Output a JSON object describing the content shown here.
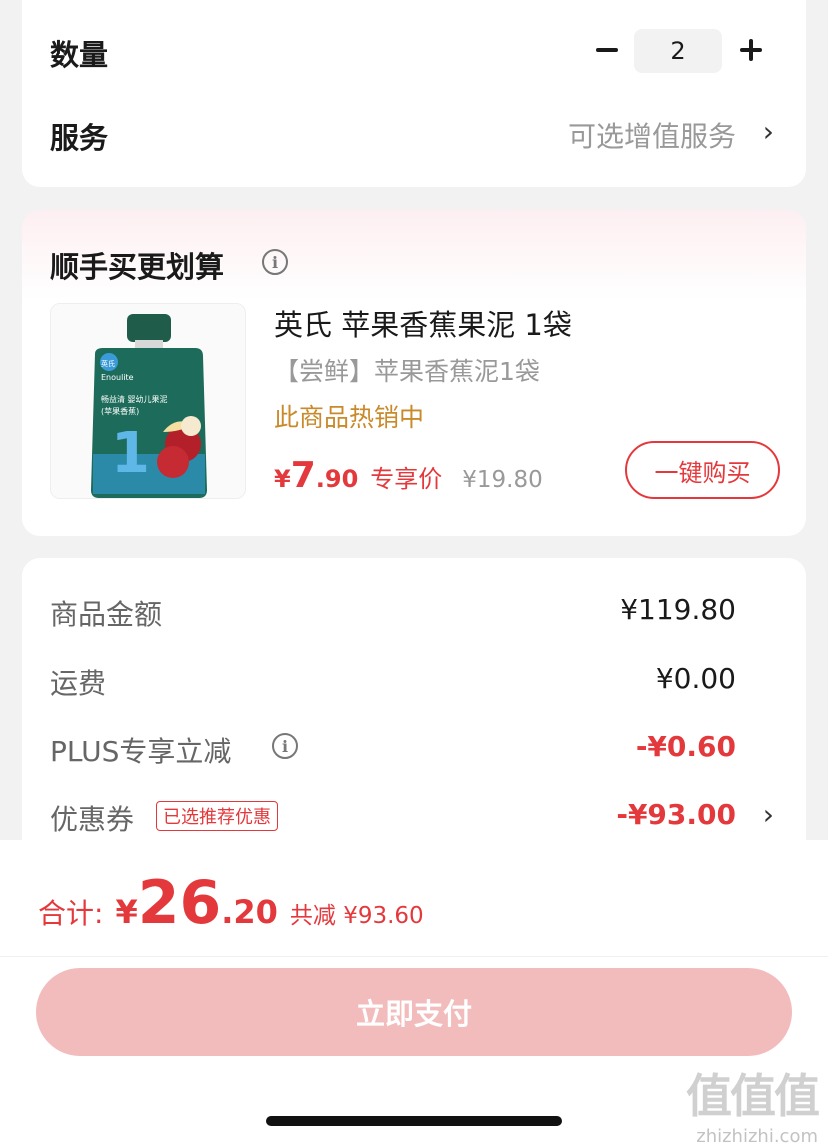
{
  "quantity": {
    "label": "数量",
    "value": "2"
  },
  "service": {
    "label": "服务",
    "value": "可选增值服务"
  },
  "bundle": {
    "title": "顺手买更划算",
    "product": {
      "name": "英氏 苹果香蕉果泥 1袋",
      "subtitle": "【尝鲜】苹果香蕉泥1袋",
      "hot": "此商品热销中",
      "price_yen": "¥",
      "price_int": "7",
      "price_dec": ".90",
      "price_tag": "专享价",
      "original_price": "¥19.80",
      "buy_button": "一键购买",
      "pack_brand": "英氏",
      "pack_brand_en": "Enoulite",
      "pack_name": "畅益清 婴幼儿果泥",
      "pack_flavor": "(苹果香蕉)",
      "pack_stage": "1"
    }
  },
  "amounts": {
    "goods_label": "商品金额",
    "goods_value": "¥119.80",
    "shipping_label": "运费",
    "shipping_value": "¥0.00",
    "plus_label": "PLUS专享立减",
    "plus_value": "-¥0.60",
    "coupon_label": "优惠券",
    "coupon_badge": "已选推荐优惠",
    "coupon_value": "-¥93.00"
  },
  "total": {
    "label": "合计:",
    "yen": "¥",
    "int": "26",
    "dec": ".20",
    "saved": "共减 ¥93.60"
  },
  "pay_button": "立即支付",
  "watermark": {
    "logo": "值值值",
    "site": "zhizhizhi.com"
  },
  "colors": {
    "accent_red": "#e4393c",
    "pay_button_bg": "#f2bcbc",
    "hot_text": "#c98a2c"
  }
}
